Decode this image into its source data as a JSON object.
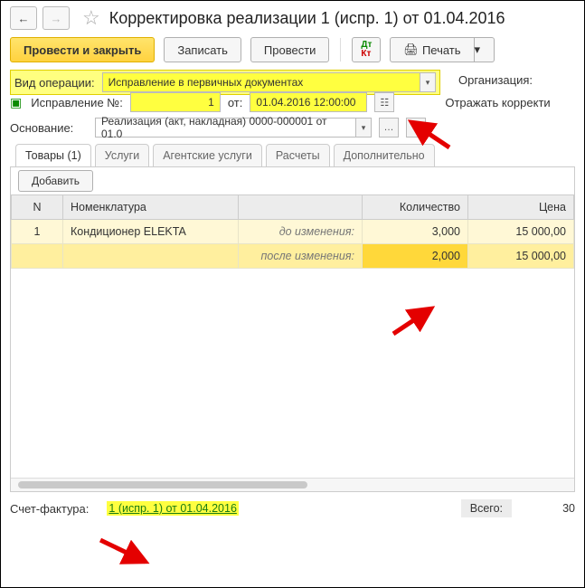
{
  "header": {
    "title": "Корректировка реализации 1 (испр. 1) от 01.04.2016"
  },
  "toolbar": {
    "post_and_close": "Провести и закрыть",
    "save": "Записать",
    "post": "Провести",
    "print_label": "Печать"
  },
  "op": {
    "label": "Вид операции:",
    "value": "Исправление в первичных документах",
    "org_label": "Организация:"
  },
  "corr": {
    "num_label": "Исправление №:",
    "num_value": "1",
    "from_label": "от:",
    "date_value": "01.04.2016 12:00:00",
    "reflect_label": "Отражать корректи"
  },
  "basis": {
    "label": "Основание:",
    "value": "Реализация (акт, накладная) 0000-000001 от 01.0"
  },
  "tabs": {
    "goods": "Товары (1)",
    "services": "Услуги",
    "agent": "Агентские услуги",
    "calc": "Расчеты",
    "more": "Дополнительно"
  },
  "table": {
    "add": "Добавить",
    "cols": {
      "n": "N",
      "nomen": "Номенклатура",
      "qty": "Количество",
      "price": "Цена"
    },
    "before_label": "до изменения:",
    "after_label": "после изменения:",
    "row": {
      "n": "1",
      "nomen": "Кондиционер ELEKTA",
      "qty_before": "3,000",
      "price_before": "15 000,00",
      "qty_after": "2,000",
      "price_after": "15 000,00"
    }
  },
  "footer": {
    "sf_label": "Счет-фактура:",
    "sf_link": "1 (испр. 1) от 01.04.2016",
    "total_label": "Всего:",
    "total_value": "30"
  }
}
